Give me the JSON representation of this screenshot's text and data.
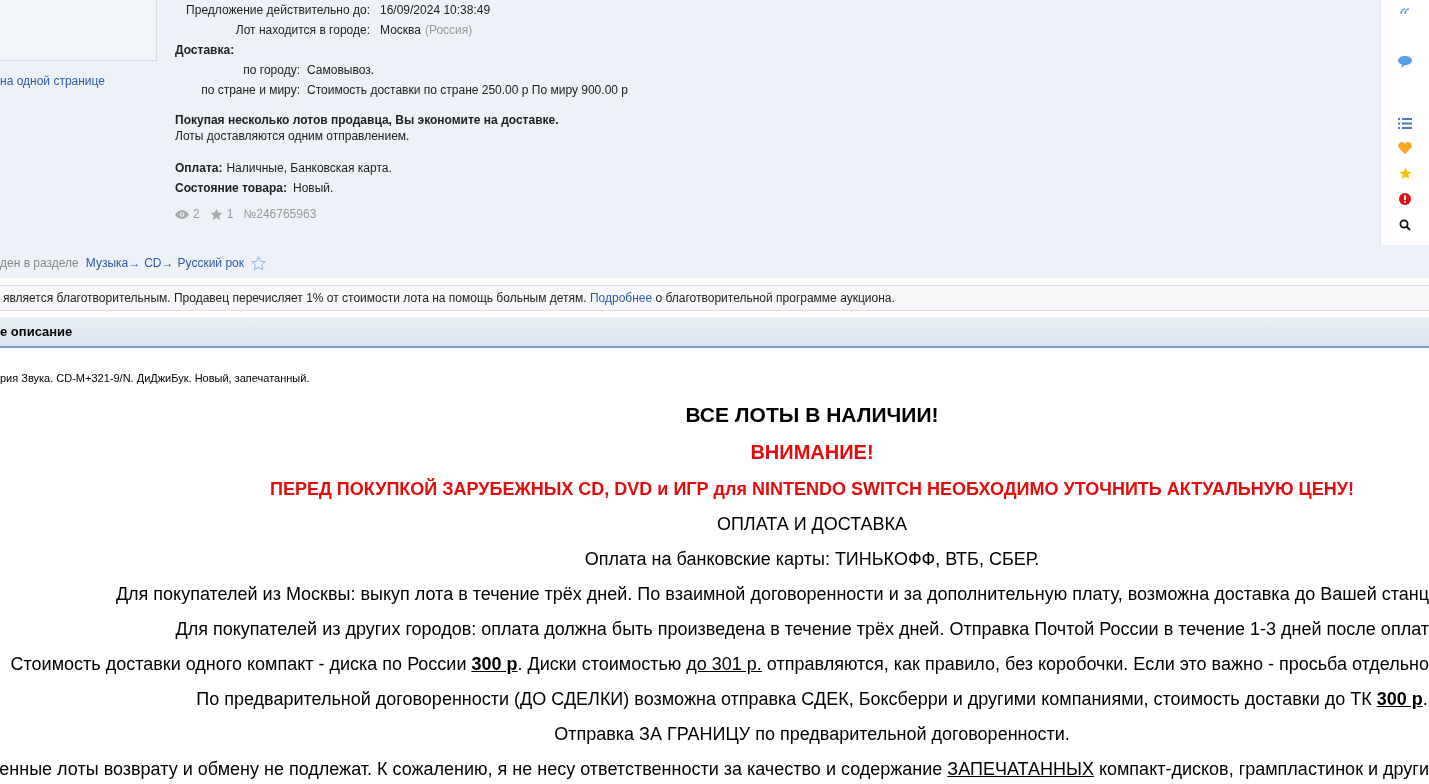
{
  "lot": {
    "offer_label": "Предложение действительно до:",
    "offer_value": "16/09/2024 10:38:49",
    "city_label": "Лот находится в городе:",
    "city": "Москва",
    "country": "(Россия)",
    "delivery_title": "Доставка:",
    "delivery": [
      {
        "label": "по городу:",
        "value": "Самовывоз."
      },
      {
        "label": "по стране и миру:",
        "value": "Стоимость доставки по стране 250.00 р По миру 900.00 р"
      }
    ],
    "combine_title": "Покупая несколько лотов продавца, Вы экономите на доставке.",
    "combine_text": "Лоты доставляются одним отправлением.",
    "payment_label": "Оплата:",
    "payment": "Наличные, Банковская карта.",
    "condition_label": "Состояние товара:",
    "condition": "Новый.",
    "views": "2",
    "favorites": "1",
    "lot_number": "№246765963"
  },
  "left": {
    "link": "на одной странице"
  },
  "category": {
    "label": "ден в разделе",
    "crumbs": [
      "Музыка→",
      "CD→",
      "Русский рок"
    ]
  },
  "charity": {
    "before": "является благотворительным. Продавец перечисляет 1% от стоимости лота на помощь больным детям.",
    "link": "Подробнее",
    "after": "о благотворительной программе аукциона."
  },
  "description": {
    "header": "е описание",
    "summary": "рия Звука. CD-M+321-9/N. ДиДжиБук. Новый, запечатанный.",
    "lines": [
      {
        "kind": "heading",
        "text": "ВСЕ ЛОТЫ В НАЛИЧИИ!"
      },
      {
        "kind": "alert",
        "text": "ВНИМАНИЕ!"
      },
      {
        "kind": "alert",
        "text": "ПЕРЕД ПОКУПКОЙ ЗАРУБЕЖНЫХ CD, DVD и ИГР для NINTENDO SWITCH  НЕОБХОДИМО УТОЧНИТЬ АКТУАЛЬНУЮ ЦЕНУ!"
      },
      {
        "kind": "plain",
        "text": "ОПЛАТА И ДОСТАВКА"
      },
      {
        "kind": "plain",
        "text": "Оплата на банковские карты: ТИНЬКОФФ, ВТБ, СБЕР."
      },
      {
        "kind": "plain",
        "text": "Для покупателей из Москвы: выкуп лота в течение трёх дней. По взаимной договоренности и за дополнительную плату, возможна доставка до Вашей станц"
      },
      {
        "kind": "plain",
        "text": "Для покупателей из других городов: оплата должна быть произведена в течение трёх дней. Отправка Почтой России в течение 1-3 дней после оплат"
      },
      {
        "kind": "plain",
        "text": "Стоимость доставки одного компакт - диска по России **300 р**. Диски стоимостью *до 301 р.* отправляются, как правило, без коробочки. Если это важно - просьба отдельно"
      },
      {
        "kind": "plain",
        "text": "По предварительной договоренности (ДО СДЕЛКИ) возможна отправка СДЕК, Боксберри и другими компаниями, стоимость доставки до ТК **300 р**."
      },
      {
        "kind": "plain",
        "text": "Отправка ЗА ГРАНИЦУ по предварительной договоренности."
      },
      {
        "kind": "plain",
        "text": "енные лоты возврату и обмену не подлежат. К сожалению, я не несу ответственности за качество и содержание *ЗАПЕЧАТАННЫХ* компакт-дисков, грампластинок и други"
      }
    ]
  }
}
